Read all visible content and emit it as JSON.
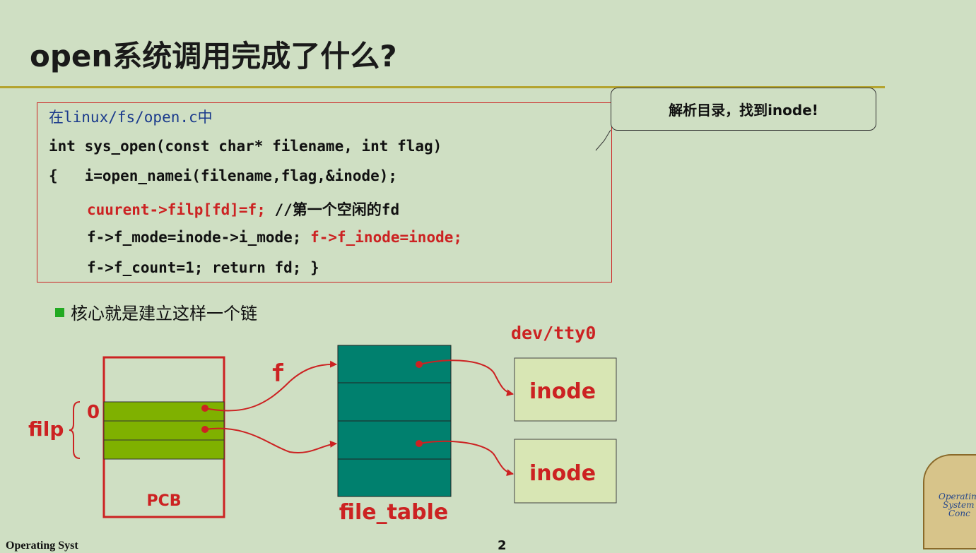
{
  "title": "open系统调用完成了什么?",
  "callout": "解析目录，找到inode!",
  "code": {
    "line1": "在linux/fs/open.c中",
    "line2": "int sys_open(const char* filename, int flag)",
    "line3": "{   i=open_namei(filename,flag,&inode);",
    "line4_red": "cuurent->filp[fd]=f;",
    "line4_comment": " //第一个空闲的fd",
    "line5_black": "f->f_mode=inode->i_mode; ",
    "line5_red": "f->f_inode=inode;",
    "line6": "f->f_count=1; return fd; }"
  },
  "bullet": "核心就是建立这样一个链",
  "diagram": {
    "filp_label": "filp",
    "zero_label": "0",
    "pcb_label": "PCB",
    "f_label": "f",
    "file_table_label": "file_table",
    "dev_label": "dev/tty0",
    "inode1": "inode",
    "inode2": "inode"
  },
  "logo": {
    "line1": "Operating",
    "line2": "System",
    "line3": "Conc"
  },
  "footer": {
    "left": "Operating Syst",
    "page": "2"
  },
  "colors": {
    "background": "#cfdfc3",
    "accent_red": "#cc2222",
    "filp_green": "#7fb100",
    "file_table_teal": "#00806e",
    "inode_fill": "#d8e6b4",
    "rule_gold": "#b4a42e"
  }
}
